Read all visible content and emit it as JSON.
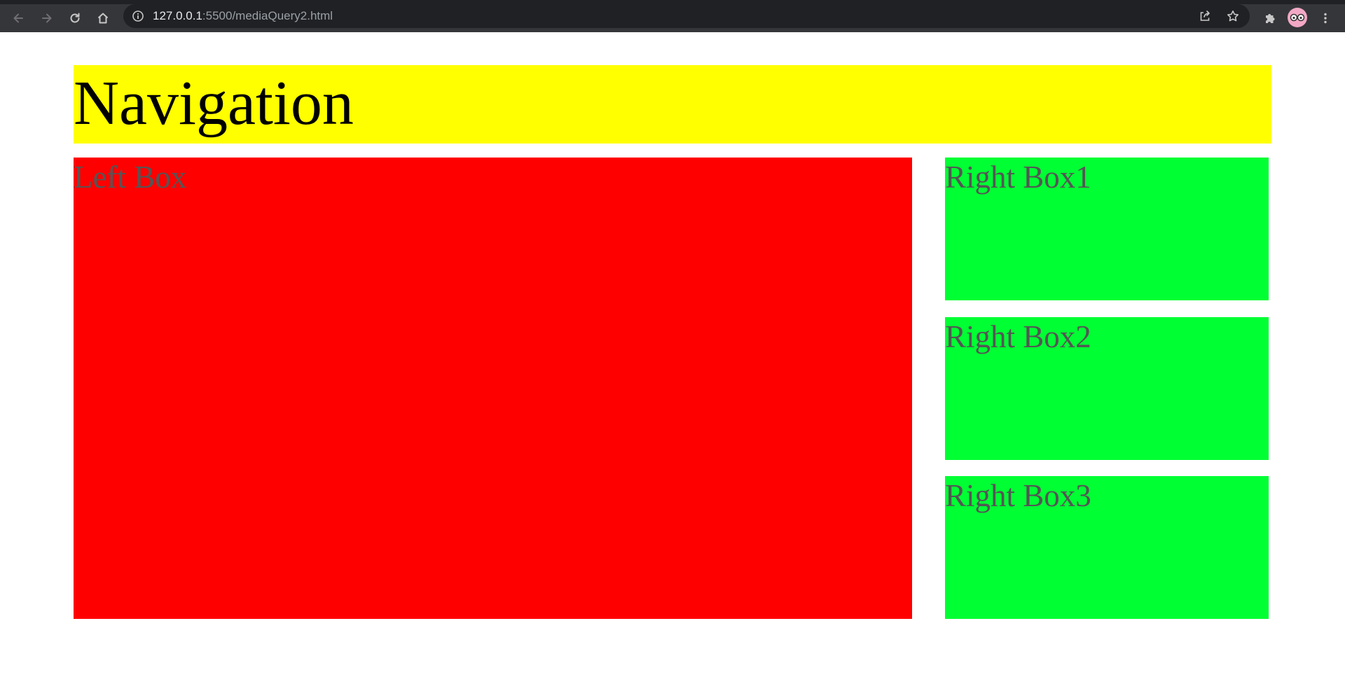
{
  "browser": {
    "url_host": "127.0.0.1",
    "url_rest": ":5500/mediaQuery2.html",
    "icons": [
      "back-arrow-icon",
      "forward-arrow-icon",
      "reload-icon",
      "home-icon",
      "info-icon",
      "share-icon",
      "star-icon",
      "extensions-icon",
      "profile-avatar",
      "menu-kebab-icon"
    ]
  },
  "page": {
    "navigation": {
      "label": "Navigation",
      "color": "#ffff00"
    },
    "left_box": {
      "label": "Left Box",
      "color": "#ff0000"
    },
    "right_boxes": [
      {
        "label": "Right Box1",
        "color": "#00ff33"
      },
      {
        "label": "Right Box2",
        "color": "#00ff33"
      },
      {
        "label": "Right Box3",
        "color": "#00ff33"
      }
    ]
  }
}
